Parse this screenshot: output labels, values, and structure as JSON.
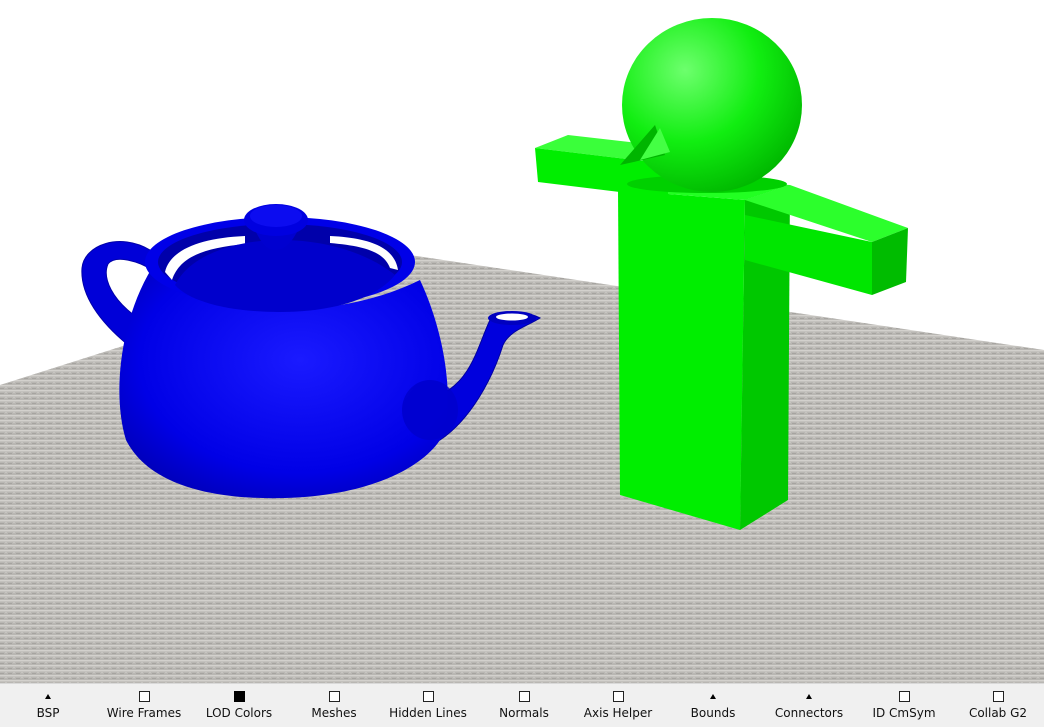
{
  "viewport": {
    "scene_objects": [
      "floor-plane",
      "teapot",
      "figure"
    ],
    "colors": {
      "teapot": "#0000e6",
      "figure": "#00ee00",
      "floor": "#b8b6b2",
      "background": "#ffffff"
    }
  },
  "toolbar": {
    "items": [
      {
        "label": "BSP",
        "marker": "triangle",
        "checked": null
      },
      {
        "label": "Wire Frames",
        "marker": "checkbox",
        "checked": false
      },
      {
        "label": "LOD Colors",
        "marker": "checkbox",
        "checked": true
      },
      {
        "label": "Meshes",
        "marker": "checkbox",
        "checked": false
      },
      {
        "label": "Hidden Lines",
        "marker": "checkbox",
        "checked": false
      },
      {
        "label": "Normals",
        "marker": "checkbox",
        "checked": false
      },
      {
        "label": "Axis Helper",
        "marker": "checkbox",
        "checked": false
      },
      {
        "label": "Bounds",
        "marker": "triangle",
        "checked": null
      },
      {
        "label": "Connectors",
        "marker": "triangle",
        "checked": null
      },
      {
        "label": "ID CmSym",
        "marker": "checkbox",
        "checked": false
      },
      {
        "label": "Collab G2",
        "marker": "checkbox",
        "checked": false
      }
    ]
  }
}
